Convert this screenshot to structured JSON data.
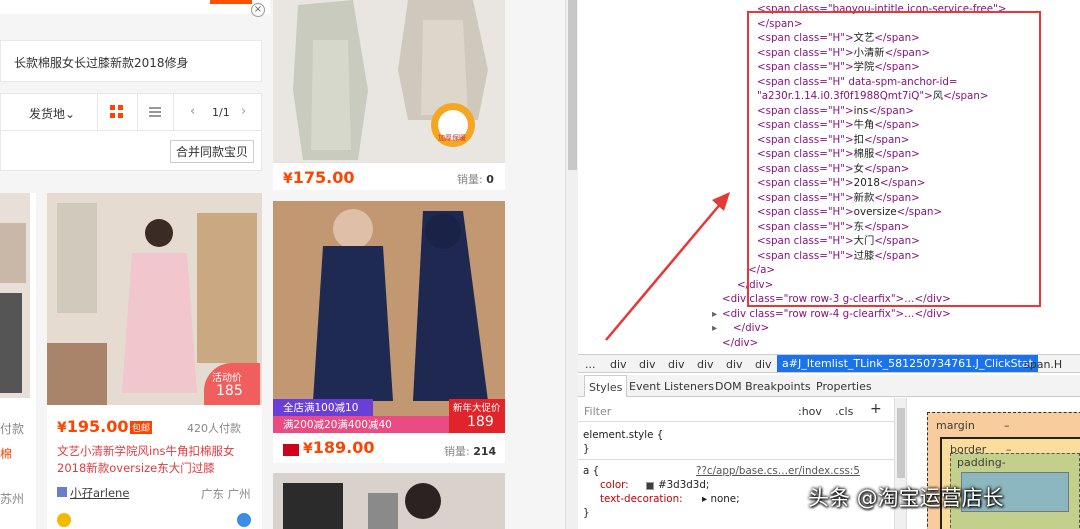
{
  "taobao": {
    "query": "长款棉服女长过膝新款2018修身",
    "filter": {
      "origin_label": "发货地",
      "pager": "1/1",
      "merge_label": "合并同款宝贝"
    },
    "products": [
      {
        "price": "175.00",
        "sales_label": "销量:",
        "sales": "0",
        "badge": "加厚保暖"
      },
      {
        "price": "195.00",
        "tag": "包邮",
        "buyers": "420人付款",
        "promo_badge_label": "活动价",
        "promo_badge_value": "185",
        "title": "文艺小清新学院风ins牛角扣棉服女2018新款oversize东大门过膝",
        "shop": "小孖arlene",
        "location": "广东 广州"
      },
      {
        "price": "189.00",
        "sales_label": "销量:",
        "sales": "214",
        "promo1": "全店满100减10",
        "promo2": "满200减20满400减40",
        "newyear_label": "新年大促价",
        "newyear_value": "189"
      }
    ],
    "edge_texts": {
      "paid": "付款",
      "cotton": "棉",
      "suzhou": "苏州"
    }
  },
  "devtools": {
    "top_line": "<span class=\"baoyou-intitle icon-service-free\">",
    "lines": [
      {
        "open": "<span class=\"H\">",
        "text": "文艺"
      },
      {
        "open": "<span class=\"H\">",
        "text": "小清新"
      },
      {
        "open": "<span class=\"H\">",
        "text": "学院"
      },
      {
        "open": "<span class=\"H\" data-spm-anchor-id=",
        "text": ""
      },
      {
        "open": "\"a230r.1.14.i0.3f0f1988Qmt7iQ\">",
        "text": "风"
      },
      {
        "open": "<span class=\"H\">",
        "text": "ins"
      },
      {
        "open": "<span class=\"H\">",
        "text": "牛角"
      },
      {
        "open": "<span class=\"H\">",
        "text": "扣"
      },
      {
        "open": "<span class=\"H\">",
        "text": "棉服"
      },
      {
        "open": "<span class=\"H\">",
        "text": "女"
      },
      {
        "open": "<span class=\"H\">",
        "text": "2018"
      },
      {
        "open": "<span class=\"H\">",
        "text": "新款"
      },
      {
        "open": "<span class=\"H\">",
        "text": "oversize"
      },
      {
        "open": "<span class=\"H\">",
        "text": "东"
      },
      {
        "open": "<span class=\"H\">",
        "text": "大门"
      },
      {
        "open": "<span class=\"H\">",
        "text": "过膝"
      }
    ],
    "close_span": "</span>",
    "close_a": "</a>",
    "close_div": "</div>",
    "row3": "<div class=\"row row-3 g-clearfix\">…</div>",
    "row4": "<div class=\"row row-4 g-clearfix\">…</div>",
    "breadcrumb": [
      "...",
      "div",
      "div",
      "div",
      "div",
      "div",
      "div"
    ],
    "breadcrumb_active": "a#J_Itemlist_TLink_581250734761.J_ClickStat",
    "breadcrumb_last": "span.H",
    "tabs": [
      "Styles",
      "Event Listeners",
      "DOM Breakpoints",
      "Properties"
    ],
    "styles": {
      "filter_placeholder": "Filter",
      "hov": ":hov",
      "cls": ".cls",
      "plus": "+",
      "element_style": "element.style {",
      "close_brace": "}",
      "rule_selector": "a {",
      "rule_source": "??c/app/base.cs…er/index.css:5",
      "prop_color": "color:",
      "val_color": "#3d3d3d;",
      "prop_decoration": "text-decoration:",
      "val_decoration": "none;"
    },
    "box_model": {
      "margin": "margin",
      "border": "border",
      "padding": "padding-",
      "dash": "–"
    }
  },
  "watermark": "头条 @淘宝运营店长",
  "colors": {
    "taobao_orange": "#ff4400",
    "highlight_red": "#e53935",
    "devtools_blue": "#1a73e8"
  }
}
